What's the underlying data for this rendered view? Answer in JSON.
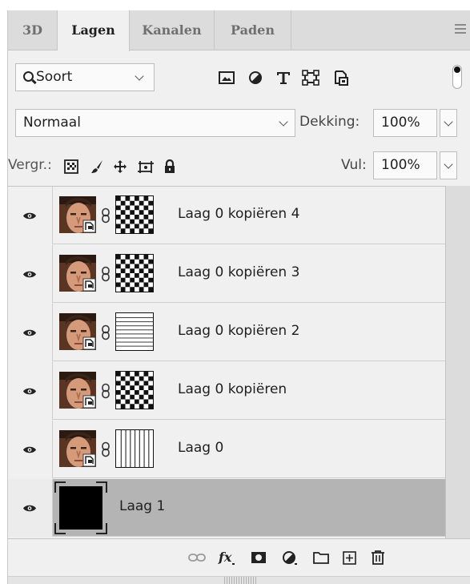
{
  "tabs": [
    {
      "label": "3D",
      "active": false
    },
    {
      "label": "Lagen",
      "active": true
    },
    {
      "label": "Kanalen",
      "active": false
    },
    {
      "label": "Paden",
      "active": false
    }
  ],
  "filter": {
    "kind_label": "Soort",
    "icons": [
      "pixel-filter-icon",
      "adjustment-filter-icon",
      "type-filter-icon",
      "shape-filter-icon",
      "smart-object-filter-icon"
    ]
  },
  "blend": {
    "mode": "Normaal",
    "opacity_label": "Dekking:",
    "opacity_value": "100%"
  },
  "locks": {
    "label": "Vergr.:",
    "icons": [
      "lock-transparent-icon",
      "lock-image-icon",
      "lock-position-icon",
      "lock-artboard-icon",
      "lock-all-icon"
    ],
    "fill_label": "Vul:",
    "fill_value": "100%"
  },
  "layers": [
    {
      "name": "Laag 0 kopiëren 4",
      "mask": "dots",
      "selected": false
    },
    {
      "name": "Laag 0 kopiëren 3",
      "mask": "dots",
      "selected": false
    },
    {
      "name": "Laag 0 kopiëren 2",
      "mask": "horizontal-lines",
      "selected": false
    },
    {
      "name": "Laag 0 kopiëren",
      "mask": "dots",
      "selected": false
    },
    {
      "name": "Laag 0",
      "mask": "vertical-lines",
      "selected": false
    },
    {
      "name": "Laag 1",
      "mask": "none",
      "selected": true
    }
  ],
  "footer_icons": [
    "link-layers-icon",
    "fx-icon",
    "add-mask-icon",
    "adjustment-layer-icon",
    "group-folder-icon",
    "new-layer-icon",
    "trash-icon"
  ],
  "colors": {
    "panel_bg": "#f0f0f0",
    "tab_bar": "#dcdcdc",
    "selected_layer": "#b4b4b4"
  }
}
